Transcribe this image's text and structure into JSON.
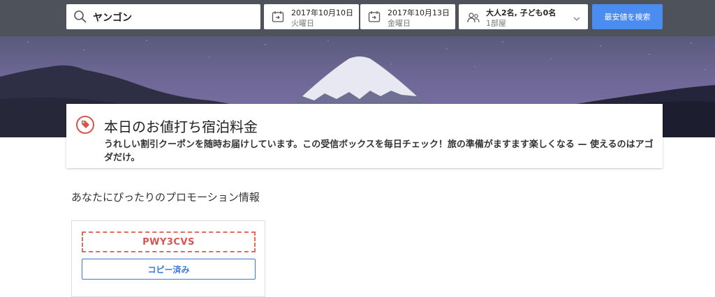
{
  "search": {
    "destination": "ヤンゴン",
    "checkin": {
      "date": "2017年10月10日",
      "weekday": "火曜日"
    },
    "checkout": {
      "date": "2017年10月13日",
      "weekday": "金曜日"
    },
    "guests": {
      "line1": "大人2名, 子ども0名",
      "line2": "1部屋"
    },
    "button_label": "最安値を検索"
  },
  "deal": {
    "title": "本日のお値打ち宿泊料金",
    "description": "うれしい割引クーポンを随時お届けしています。この受信ボックスを毎日チェック！旅の準備がますます楽しくなる — 使えるのはアゴダだけ。"
  },
  "promotions": {
    "section_title": "あなたにぴったりのプロモーション情報",
    "coupon_code": "PWY3CVS",
    "copy_button_label": "コピー済み"
  },
  "colors": {
    "topbar": "#4e535b",
    "accent_blue": "#4a8cf0",
    "coupon_red": "#d9534f"
  }
}
